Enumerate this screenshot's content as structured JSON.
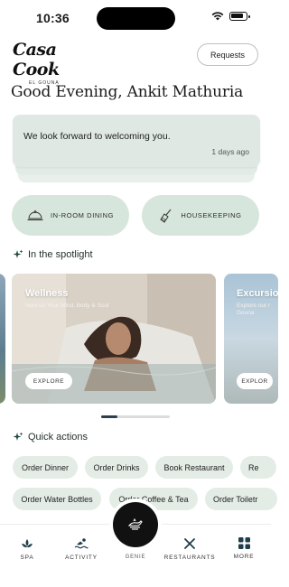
{
  "status_bar": {
    "time": "10:36"
  },
  "header": {
    "logo_text": "Casa Cook",
    "logo_subtext": "EL GOUNA",
    "requests_label": "Requests"
  },
  "greeting": "Good Evening, Ankit Mathuria",
  "message": {
    "text": "We look forward to welcoming you.",
    "time": "1 days ago"
  },
  "services": [
    {
      "label": "IN-ROOM DINING",
      "icon": "cloche-icon"
    },
    {
      "label": "HOUSEKEEPING",
      "icon": "broom-icon"
    }
  ],
  "spotlight": {
    "title": "In the spotlight",
    "cards": [
      {
        "title": "Wellness",
        "subtitle": "Nourish Your Mind, Body & Soul",
        "button": "EXPLORE"
      },
      {
        "title": "Excursio",
        "subtitle": "Explore our r",
        "subtitle2": "Gouna",
        "button": "EXPLOR"
      }
    ]
  },
  "quick_actions": {
    "title": "Quick actions",
    "row1": [
      "Order Dinner",
      "Order Drinks",
      "Book Restaurant",
      "Re"
    ],
    "row2": [
      "Order Water Bottles",
      "Order Coffee & Tea",
      "Order Toiletr"
    ]
  },
  "bottom_nav": {
    "items": [
      {
        "label": "SPA",
        "icon": "lotus-icon"
      },
      {
        "label": "ACTIVITY",
        "icon": "swimmer-icon"
      },
      {
        "label": "RESTAURANTS",
        "icon": "cutlery-icon"
      },
      {
        "label": "MORE",
        "icon": "grid-icon"
      }
    ],
    "center_label": "GENIE",
    "center_icon": "genie-lamp-icon"
  },
  "colors": {
    "accent_green": "#d7e6dc",
    "chip_bg": "#e4ece6",
    "card_bg": "#dfe8e2",
    "dark": "#111111"
  }
}
